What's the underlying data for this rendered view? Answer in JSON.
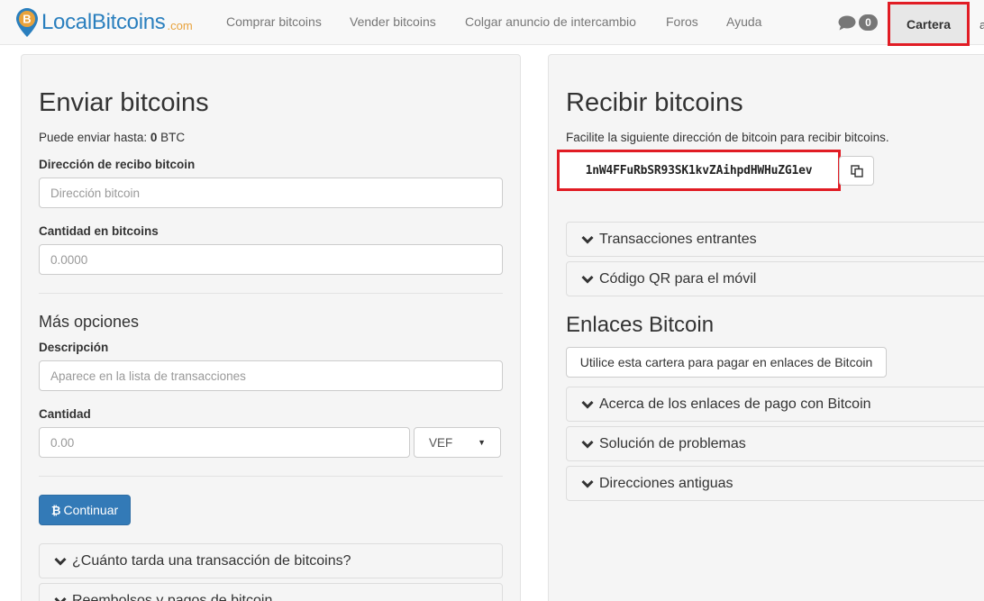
{
  "navbar": {
    "logo_text": "LocalBitcoins",
    "logo_suffix": ".com",
    "links": [
      "Comprar bitcoins",
      "Vender bitcoins",
      "Colgar anuncio de intercambio",
      "Foros",
      "Ayuda"
    ],
    "message_count": "0",
    "wallet_label": "Cartera"
  },
  "send": {
    "title": "Enviar bitcoins",
    "limit_prefix": "Puede enviar hasta: ",
    "limit_amount": "0",
    "limit_unit": " BTC",
    "address_label": "Dirección de recibo bitcoin",
    "address_placeholder": "Dirección bitcoin",
    "amount_label": "Cantidad en bitcoins",
    "amount_placeholder": "0.0000",
    "more_options_title": "Más opciones",
    "description_label": "Descripción",
    "description_placeholder": "Aparece en la lista de transacciones",
    "fiat_amount_label": "Cantidad",
    "fiat_amount_placeholder": "0.00",
    "currency_selected": "VEF",
    "continue_label": "Continuar",
    "faq": [
      "¿Cuánto tarda una transacción de bitcoins?",
      "Reembolsos y pagos de bitcoin"
    ]
  },
  "receive": {
    "title": "Recibir bitcoins",
    "instructions": "Facilite la siguiente dirección de bitcoin para recibir bitcoins.",
    "address": "1nW4FFuRbSR93SK1kvZAihpdHWHuZG1ev",
    "sections": [
      "Transacciones entrantes",
      "Código QR para el móvil"
    ],
    "links_title": "Enlaces Bitcoin",
    "links_button": "Utilice esta cartera para pagar en enlaces de Bitcoin",
    "links_sections": [
      "Acerca de los enlaces de pago con Bitcoin",
      "Solución de problemas",
      "Direcciones antiguas"
    ]
  },
  "colors": {
    "primary": "#337ab7",
    "highlight": "#e11c24",
    "brand_blue": "#2a7fbe",
    "brand_orange": "#e8a23c"
  },
  "icons": [
    "bitcoin-logo-icon",
    "chat-bubble-icon",
    "chevron-down-icon",
    "copy-icon",
    "bitcoin-icon"
  ]
}
